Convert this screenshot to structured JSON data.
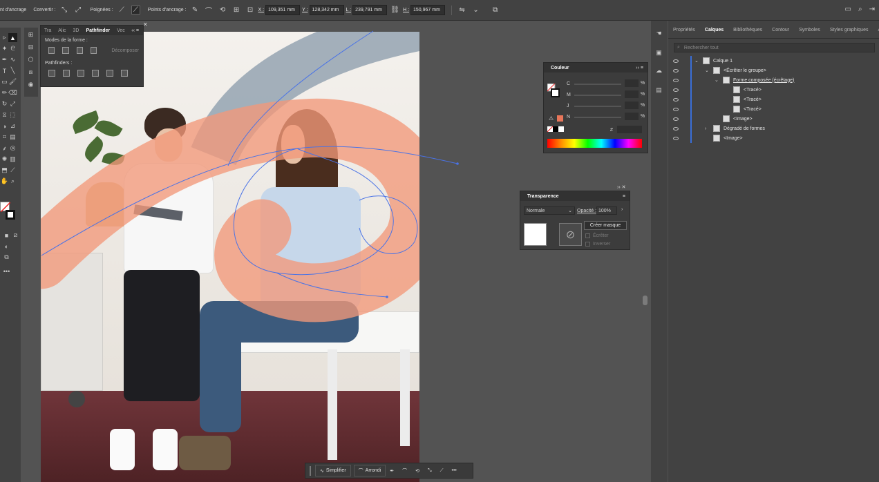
{
  "control_bar": {
    "anchor_label": "nt d'ancrage",
    "convert_label": "Convertir :",
    "handles_label": "Poignées :",
    "anchors_label": "Points d'ancrage :",
    "x_label": "X :",
    "x_value": "109,351 mm",
    "y_label": "Y :",
    "y_value": "128,342 mm",
    "w_label": "L :",
    "w_value": "239,791 mm",
    "h_label": "H :",
    "h_value": "150,967 mm"
  },
  "pathfinder_panel": {
    "tabs": [
      "Tra",
      "Alic",
      "3D",
      "Pathfinder",
      "Vec"
    ],
    "shape_modes_label": "Modes de la forme :",
    "expand_label": "Décomposer",
    "pathfinders_label": "Pathfinders :"
  },
  "color_panel": {
    "title": "Couleur",
    "channels": [
      "C",
      "M",
      "J",
      "N"
    ],
    "percent": "%",
    "hash": "#",
    "accent_color": "#e8765a"
  },
  "transparency_panel": {
    "title": "Transparence",
    "blend_mode": "Normale",
    "opacity_label": "Opacité :",
    "opacity_value": "100%",
    "make_mask_label": "Créer masque",
    "clip_label": "Écrêter",
    "invert_label": "Inverser"
  },
  "layers_panel": {
    "tabs": [
      "Propriétés",
      "Calques",
      "Bibliothèques",
      "Contour",
      "Symboles",
      "Styles graphiques",
      "Aspect"
    ],
    "active_tab": "Calques",
    "search_placeholder": "Rechercher tout",
    "rows": [
      {
        "label": "Calque 1"
      },
      {
        "label": "<Écrêter le groupe>"
      },
      {
        "label": "Forme composée (écrêtage)"
      },
      {
        "label": "<Tracé>"
      },
      {
        "label": "<Tracé>"
      },
      {
        "label": "<Tracé>"
      },
      {
        "label": "<Image>"
      },
      {
        "label": "Dégradé de formes"
      },
      {
        "label": "<Image>"
      }
    ]
  },
  "bottom_toolbar": {
    "simplify_label": "Simplifier",
    "round_label": "Arrondi"
  },
  "colors": {
    "path_blue": "#4a73e6",
    "layer_blue": "#3a6fd8",
    "peach": "#f2997a"
  }
}
